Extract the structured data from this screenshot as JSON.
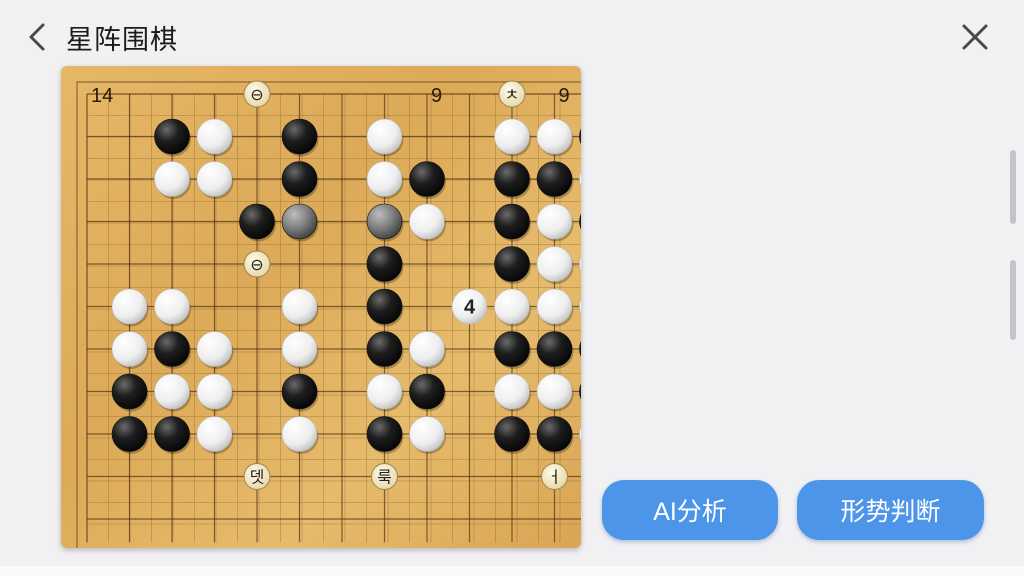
{
  "header": {
    "title": "星阵围棋",
    "back_icon": "chevron-left-icon",
    "close_icon": "close-icon"
  },
  "board": {
    "size": "19x19",
    "coordinate_labels": [
      {
        "text": "14",
        "pos": [
          0,
          0
        ]
      },
      {
        "text": "9",
        "pos": [
          0,
          8
        ]
      },
      {
        "text": "9",
        "pos": [
          0,
          11
        ]
      }
    ],
    "stones": [
      {
        "color": "black",
        "pos": [
          1,
          2
        ]
      },
      {
        "color": "white",
        "pos": [
          1,
          3
        ]
      },
      {
        "color": "black",
        "pos": [
          1,
          5
        ]
      },
      {
        "color": "white",
        "pos": [
          1,
          7
        ]
      },
      {
        "color": "white",
        "pos": [
          1,
          10
        ]
      },
      {
        "color": "white",
        "pos": [
          1,
          11
        ]
      },
      {
        "color": "black",
        "pos": [
          1,
          12
        ]
      },
      {
        "color": "white",
        "pos": [
          2,
          2
        ]
      },
      {
        "color": "white",
        "pos": [
          2,
          3
        ]
      },
      {
        "color": "black",
        "pos": [
          2,
          5
        ]
      },
      {
        "color": "white",
        "pos": [
          2,
          7
        ]
      },
      {
        "color": "black",
        "pos": [
          2,
          8
        ]
      },
      {
        "color": "black",
        "pos": [
          2,
          10
        ]
      },
      {
        "color": "black",
        "pos": [
          2,
          11
        ]
      },
      {
        "color": "white",
        "pos": [
          2,
          12
        ]
      },
      {
        "color": "black",
        "pos": [
          3,
          4
        ]
      },
      {
        "color": "gray",
        "pos": [
          3,
          5
        ]
      },
      {
        "color": "gray",
        "pos": [
          3,
          7
        ]
      },
      {
        "color": "white",
        "pos": [
          3,
          8
        ]
      },
      {
        "color": "black",
        "pos": [
          3,
          10
        ]
      },
      {
        "color": "white",
        "pos": [
          3,
          11
        ]
      },
      {
        "color": "black",
        "pos": [
          3,
          12
        ]
      },
      {
        "color": "black",
        "pos": [
          4,
          7
        ]
      },
      {
        "color": "black",
        "pos": [
          4,
          10
        ]
      },
      {
        "color": "white",
        "pos": [
          4,
          11
        ]
      },
      {
        "color": "white",
        "pos": [
          5,
          1
        ]
      },
      {
        "color": "white",
        "pos": [
          5,
          2
        ]
      },
      {
        "color": "white",
        "pos": [
          5,
          5
        ]
      },
      {
        "color": "black",
        "pos": [
          5,
          7
        ]
      },
      {
        "color": "white",
        "pos": [
          5,
          10
        ]
      },
      {
        "color": "white",
        "pos": [
          5,
          11
        ]
      },
      {
        "color": "white",
        "pos": [
          5,
          12
        ]
      },
      {
        "color": "white",
        "pos": [
          6,
          1
        ]
      },
      {
        "color": "black",
        "pos": [
          6,
          2
        ]
      },
      {
        "color": "white",
        "pos": [
          6,
          3
        ]
      },
      {
        "color": "white",
        "pos": [
          6,
          5
        ]
      },
      {
        "color": "black",
        "pos": [
          6,
          7
        ]
      },
      {
        "color": "white",
        "pos": [
          6,
          8
        ]
      },
      {
        "color": "black",
        "pos": [
          6,
          10
        ]
      },
      {
        "color": "black",
        "pos": [
          6,
          11
        ]
      },
      {
        "color": "black",
        "pos": [
          6,
          12
        ]
      },
      {
        "color": "black",
        "pos": [
          7,
          1
        ]
      },
      {
        "color": "white",
        "pos": [
          7,
          2
        ]
      },
      {
        "color": "white",
        "pos": [
          7,
          3
        ]
      },
      {
        "color": "black",
        "pos": [
          7,
          5
        ]
      },
      {
        "color": "white",
        "pos": [
          7,
          7
        ]
      },
      {
        "color": "black",
        "pos": [
          7,
          8
        ]
      },
      {
        "color": "white",
        "pos": [
          7,
          10
        ]
      },
      {
        "color": "white",
        "pos": [
          7,
          11
        ]
      },
      {
        "color": "black",
        "pos": [
          7,
          12
        ]
      },
      {
        "color": "black",
        "pos": [
          8,
          1
        ]
      },
      {
        "color": "black",
        "pos": [
          8,
          2
        ]
      },
      {
        "color": "white",
        "pos": [
          8,
          3
        ]
      },
      {
        "color": "white",
        "pos": [
          8,
          5
        ]
      },
      {
        "color": "black",
        "pos": [
          8,
          7
        ]
      },
      {
        "color": "white",
        "pos": [
          8,
          8
        ]
      },
      {
        "color": "black",
        "pos": [
          8,
          10
        ]
      },
      {
        "color": "black",
        "pos": [
          8,
          11
        ]
      },
      {
        "color": "white",
        "pos": [
          8,
          12
        ]
      }
    ],
    "markers": [
      {
        "type": "labeled-white",
        "label": "4",
        "pos": [
          4,
          12
        ]
      },
      {
        "type": "labeled-white",
        "label": "4",
        "pos": [
          5,
          9
        ]
      },
      {
        "type": "small-token",
        "label": "⊖",
        "pos": [
          0,
          4
        ]
      },
      {
        "type": "small-token",
        "label": "⊖",
        "pos": [
          4,
          4
        ]
      },
      {
        "type": "small-token",
        "label": "ㅊ",
        "pos": [
          0,
          10
        ]
      },
      {
        "type": "small-token",
        "label": "뎃",
        "pos": [
          9,
          4
        ]
      },
      {
        "type": "small-token",
        "label": "룩",
        "pos": [
          9,
          7
        ]
      },
      {
        "type": "small-token",
        "label": "ㅓ",
        "pos": [
          9,
          11
        ]
      }
    ]
  },
  "buttons": {
    "ai_analysis": "AI分析",
    "position_judgement": "形势判断"
  }
}
